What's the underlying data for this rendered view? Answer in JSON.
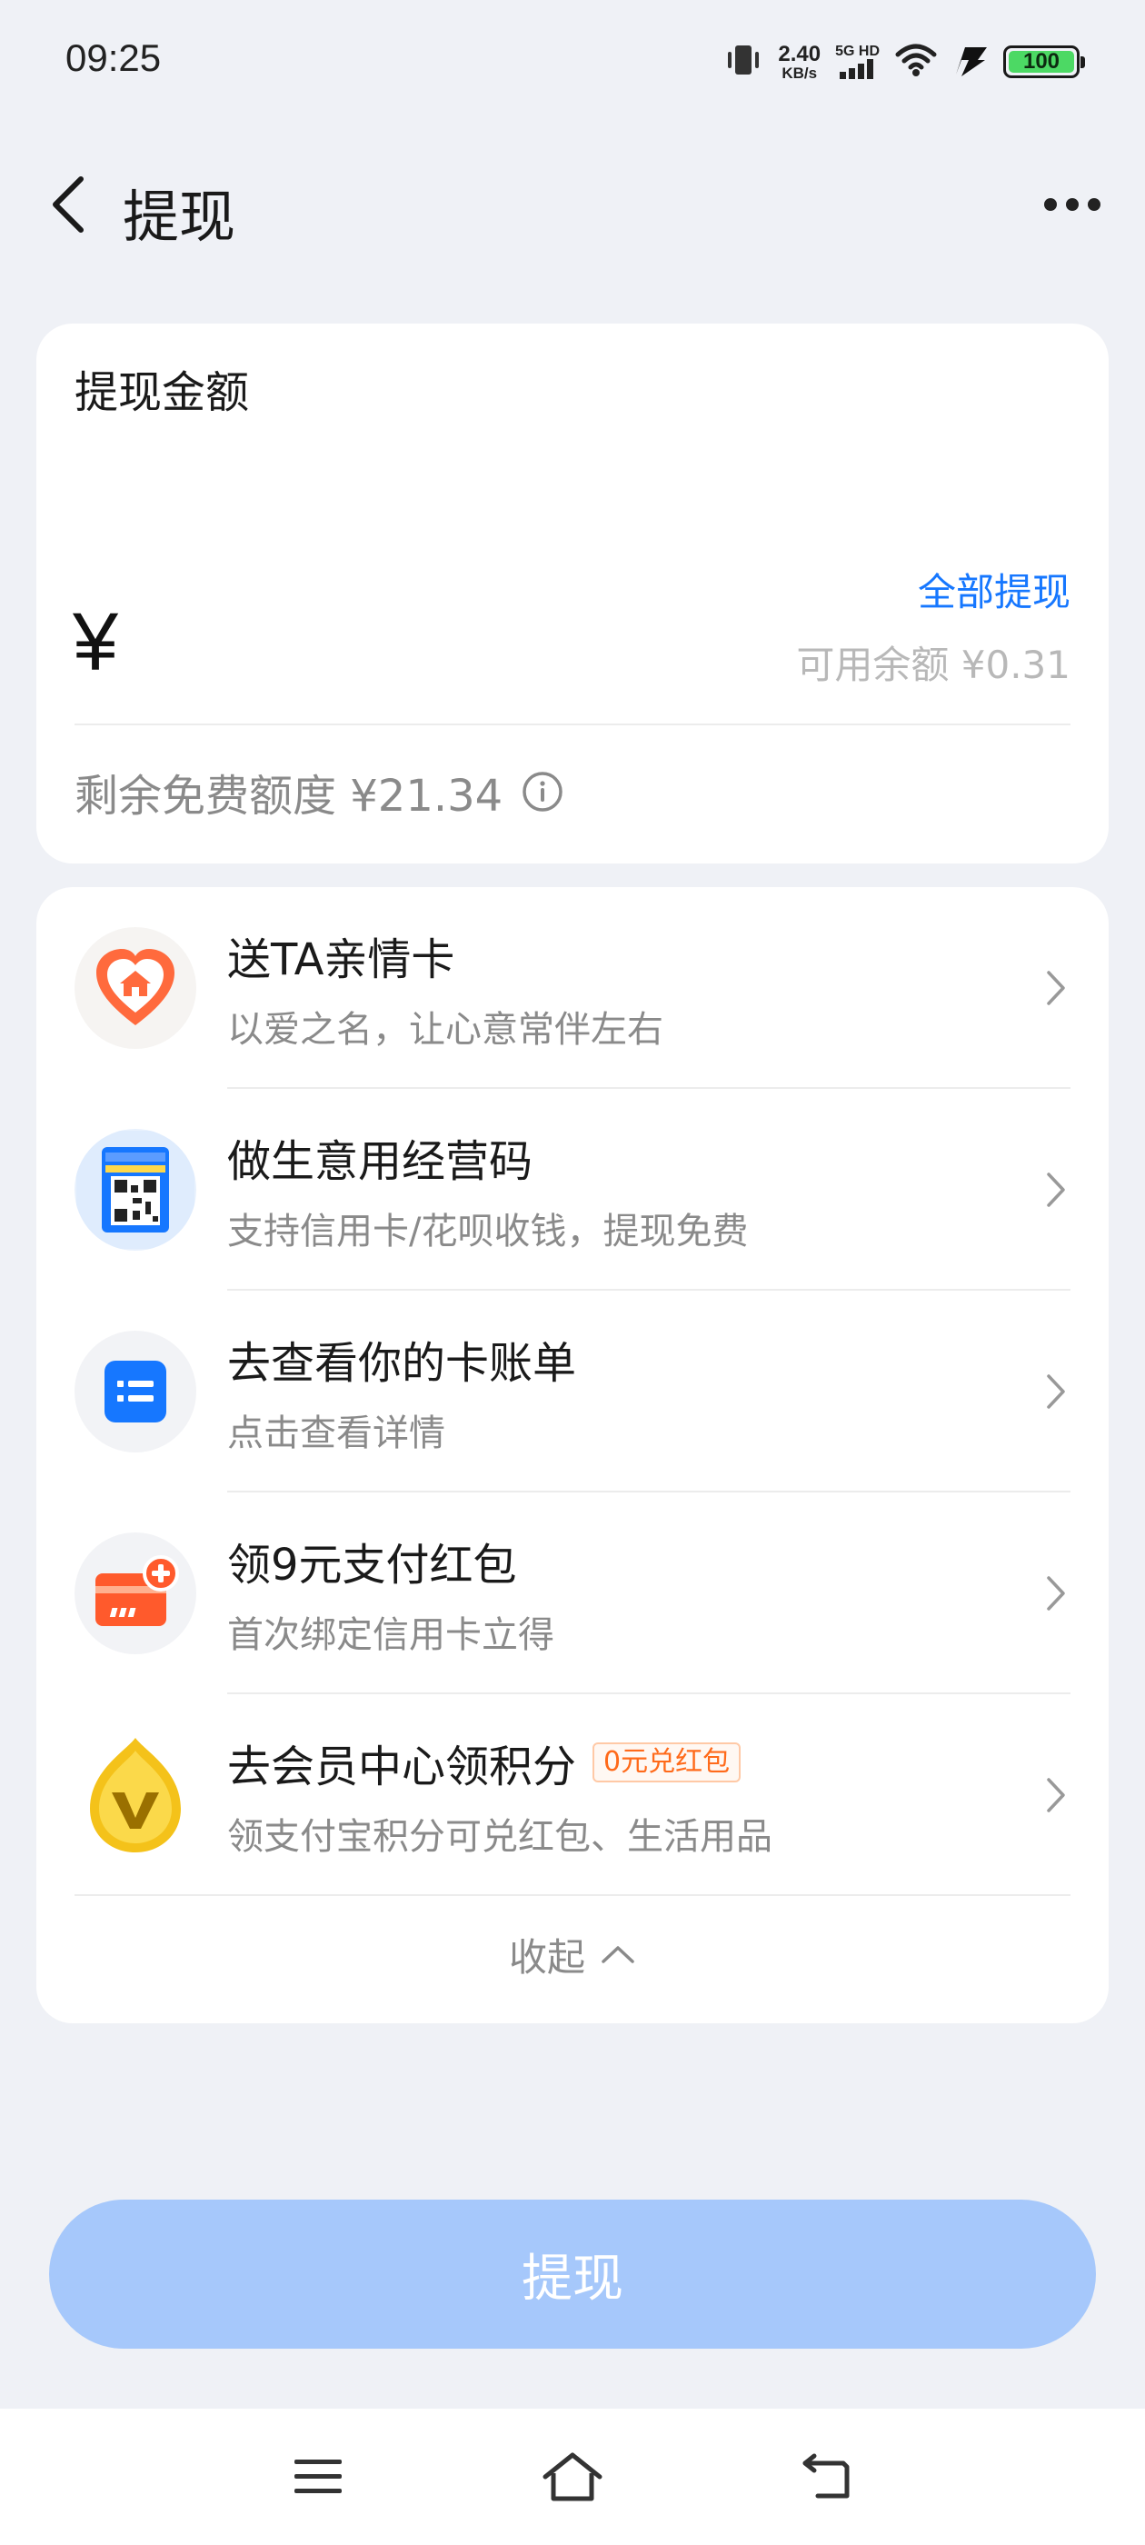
{
  "status_bar": {
    "time": "09:25",
    "net_speed_value": "2.40",
    "net_speed_unit": "KB/s",
    "net_type": "5G HD",
    "battery": "100"
  },
  "header": {
    "title": "提现"
  },
  "amount_card": {
    "label": "提现金额",
    "withdraw_all": "全部提现",
    "currency_symbol": "¥",
    "available": "可用余额 ¥0.31",
    "free_quota": "剩余免费额度 ¥21.34"
  },
  "list": {
    "items": [
      {
        "title": "送TA亲情卡",
        "subtitle": "以爱之名，让心意常伴左右",
        "icon": "heart-house-icon"
      },
      {
        "title": "做生意用经营码",
        "subtitle": "支持信用卡/花呗收钱，提现免费",
        "icon": "qr-code-icon"
      },
      {
        "title": "去查看你的卡账单",
        "subtitle": "点击查看详情",
        "icon": "bill-icon"
      },
      {
        "title": "领9元支付红包",
        "subtitle": "首次绑定信用卡立得",
        "icon": "card-plus-icon"
      },
      {
        "title": "去会员中心领积分",
        "tag": "0元兑红包",
        "subtitle": "领支付宝积分可兑红包、生活用品",
        "icon": "member-v-icon"
      }
    ],
    "collapse": "收起"
  },
  "submit_button": "提现",
  "colors": {
    "accent": "#1677ff",
    "button_disabled": "#a6c8fb",
    "background": "#eff1f6",
    "tag_orange": "#ff6a1a"
  }
}
